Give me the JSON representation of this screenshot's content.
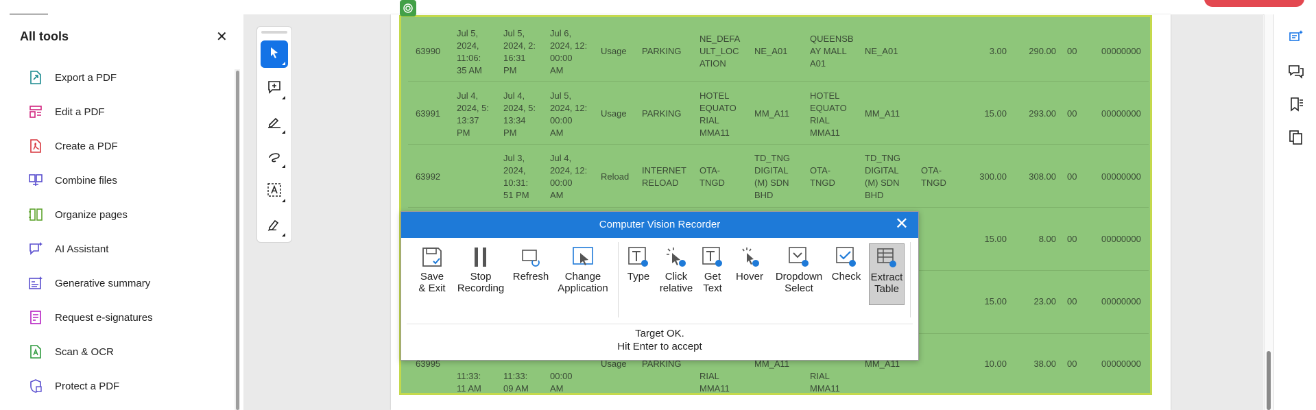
{
  "colors": {
    "accent": "#1473e6",
    "selection_green": "#8ec67a",
    "dialog_title": "#1e7ad8"
  },
  "tools_panel": {
    "title": "All tools",
    "close_icon": "close-icon",
    "items": [
      {
        "label": "Export a PDF",
        "icon": "export-pdf-icon",
        "color": "#1b8a8f"
      },
      {
        "label": "Edit a PDF",
        "icon": "edit-pdf-icon",
        "color": "#d0257e"
      },
      {
        "label": "Create a PDF",
        "icon": "create-pdf-icon",
        "color": "#d7373f"
      },
      {
        "label": "Combine files",
        "icon": "combine-files-icon",
        "color": "#5a4fcf"
      },
      {
        "label": "Organize pages",
        "icon": "organize-pages-icon",
        "color": "#5ea32e"
      },
      {
        "label": "AI Assistant",
        "icon": "ai-assistant-icon",
        "color": "#5a4fcf"
      },
      {
        "label": "Generative summary",
        "icon": "generative-summary-icon",
        "color": "#5a4fcf"
      },
      {
        "label": "Request e-signatures",
        "icon": "request-esignatures-icon",
        "color": "#b620c2"
      },
      {
        "label": "Scan & OCR",
        "icon": "scan-ocr-icon",
        "color": "#2e9a3e"
      },
      {
        "label": "Protect a PDF",
        "icon": "protect-pdf-icon",
        "color": "#5a4fcf"
      }
    ]
  },
  "table": {
    "rows": [
      {
        "id": "63990",
        "c1": [
          "Jul 5,",
          "2024,",
          "11:06:",
          "35 AM"
        ],
        "c2": [
          "Jul 5,",
          "2024, 2:",
          "16:31",
          "PM"
        ],
        "c3": [
          "Jul 6,",
          "2024, 12:",
          "00:00",
          "AM"
        ],
        "type": "Usage",
        "cat": "PARKING",
        "loc1": [
          "NE_DEFA",
          "ULT_LOC",
          "ATION"
        ],
        "code1": "NE_A01",
        "loc2": [
          "QUEENSB",
          "AY MALL",
          "A01"
        ],
        "code2": "NE_A01",
        "extra": [],
        "amt": "3.00",
        "bal": "290.00",
        "zz": "00",
        "acct": "00000000"
      },
      {
        "id": "63991",
        "c1": [
          "Jul 4,",
          "2024, 5:",
          "13:37",
          "PM"
        ],
        "c2": [
          "Jul 4,",
          "2024, 5:",
          "13:34",
          "PM"
        ],
        "c3": [
          "Jul 5,",
          "2024, 12:",
          "00:00",
          "AM"
        ],
        "type": "Usage",
        "cat": "PARKING",
        "loc1": [
          "HOTEL",
          "EQUATO",
          "RIAL",
          "MMA11"
        ],
        "code1": "MM_A11",
        "loc2": [
          "HOTEL",
          "EQUATO",
          "RIAL",
          "MMA11"
        ],
        "code2": "MM_A11",
        "extra": [],
        "amt": "15.00",
        "bal": "293.00",
        "zz": "00",
        "acct": "00000000"
      },
      {
        "id": "63992",
        "c1": [],
        "c2": [
          "Jul 3,",
          "2024,",
          "10:31:",
          "51 PM"
        ],
        "c3": [
          "Jul 4,",
          "2024, 12:",
          "00:00",
          "AM"
        ],
        "type": "Reload",
        "cat": "INTERNET RELOAD",
        "loc1": [
          "OTA-",
          "TNGD"
        ],
        "code1": "TD_TNG DIGITAL (M) SDN BHD",
        "loc2": [
          "OTA-",
          "TNGD"
        ],
        "code2": "TD_TNG DIGITAL (M) SDN BHD",
        "extra": [
          "OTA-",
          "TNGD"
        ],
        "amt": "300.00",
        "bal": "308.00",
        "zz": "00",
        "acct": "00000000"
      },
      {
        "amt": "15.00",
        "bal": "8.00",
        "zz": "00",
        "acct": "00000000"
      },
      {
        "amt": "15.00",
        "bal": "23.00",
        "zz": "00",
        "acct": "00000000"
      },
      {
        "id": "63995",
        "c1": [
          "11:33:",
          "11 AM"
        ],
        "c2": [
          "11:33:",
          "09 AM"
        ],
        "c3": [
          "00:00",
          "AM"
        ],
        "type": "Usage",
        "cat": "PARKING",
        "loc1": [
          "RIAL",
          "MMA11"
        ],
        "code1": "MM_A11",
        "loc2": [
          "RIAL",
          "MMA11"
        ],
        "code2": "MM_A11",
        "extra": [],
        "amt": "10.00",
        "bal": "38.00",
        "zz": "00",
        "acct": "00000000"
      }
    ]
  },
  "recorder": {
    "title": "Computer Vision Recorder",
    "buttons": [
      {
        "label": "Save\n& Exit",
        "icon": "save-exit-icon"
      },
      {
        "label": "Stop\nRecording",
        "icon": "stop-recording-icon"
      },
      {
        "label": "Refresh",
        "icon": "refresh-icon"
      },
      {
        "label": "Change\nApplication",
        "icon": "change-application-icon"
      },
      {
        "label": "Type",
        "icon": "type-icon"
      },
      {
        "label": "Click\nrelative",
        "icon": "click-relative-icon"
      },
      {
        "label": "Get\nText",
        "icon": "get-text-icon"
      },
      {
        "label": "Hover",
        "icon": "hover-icon"
      },
      {
        "label": "Dropdown\nSelect",
        "icon": "dropdown-select-icon"
      },
      {
        "label": "Check",
        "icon": "check-icon"
      },
      {
        "label": "Extract\nTable",
        "icon": "extract-table-icon",
        "selected": true
      }
    ],
    "status_line1": "Target OK.",
    "status_line2": "Hit Enter to accept"
  },
  "vertical_toolbar": {
    "tools": [
      "select-pointer-icon",
      "add-comment-icon",
      "highlight-pen-icon",
      "draw-freehand-icon",
      "text-select-icon",
      "sign-icon"
    ]
  },
  "right_rail": {
    "icons": [
      "ai-assistant-icon",
      "comments-icon",
      "bookmarks-icon",
      "pages-icon"
    ]
  }
}
